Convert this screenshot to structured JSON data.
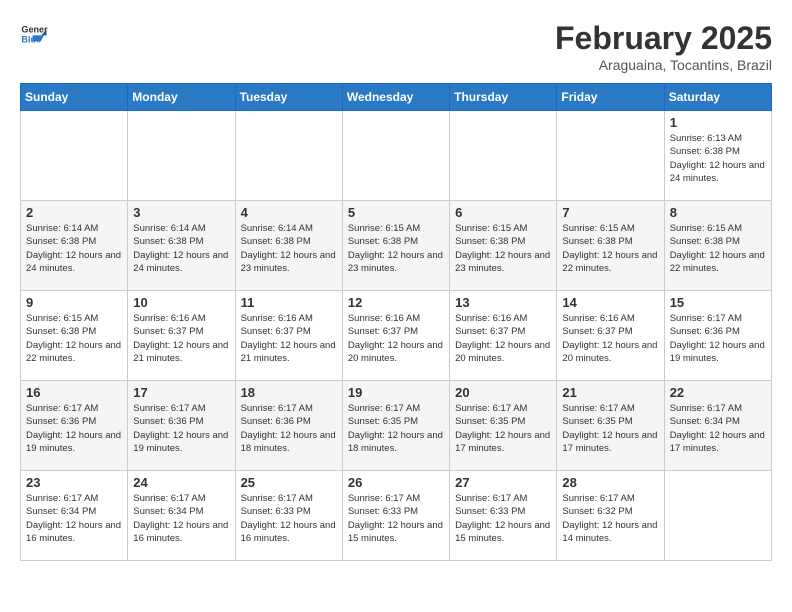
{
  "header": {
    "logo_general": "General",
    "logo_blue": "Blue",
    "month_title": "February 2025",
    "subtitle": "Araguaina, Tocantins, Brazil"
  },
  "weekdays": [
    "Sunday",
    "Monday",
    "Tuesday",
    "Wednesday",
    "Thursday",
    "Friday",
    "Saturday"
  ],
  "weeks": [
    [
      {
        "day": "",
        "info": ""
      },
      {
        "day": "",
        "info": ""
      },
      {
        "day": "",
        "info": ""
      },
      {
        "day": "",
        "info": ""
      },
      {
        "day": "",
        "info": ""
      },
      {
        "day": "",
        "info": ""
      },
      {
        "day": "1",
        "info": "Sunrise: 6:13 AM\nSunset: 6:38 PM\nDaylight: 12 hours and 24 minutes."
      }
    ],
    [
      {
        "day": "2",
        "info": "Sunrise: 6:14 AM\nSunset: 6:38 PM\nDaylight: 12 hours and 24 minutes."
      },
      {
        "day": "3",
        "info": "Sunrise: 6:14 AM\nSunset: 6:38 PM\nDaylight: 12 hours and 24 minutes."
      },
      {
        "day": "4",
        "info": "Sunrise: 6:14 AM\nSunset: 6:38 PM\nDaylight: 12 hours and 23 minutes."
      },
      {
        "day": "5",
        "info": "Sunrise: 6:15 AM\nSunset: 6:38 PM\nDaylight: 12 hours and 23 minutes."
      },
      {
        "day": "6",
        "info": "Sunrise: 6:15 AM\nSunset: 6:38 PM\nDaylight: 12 hours and 23 minutes."
      },
      {
        "day": "7",
        "info": "Sunrise: 6:15 AM\nSunset: 6:38 PM\nDaylight: 12 hours and 22 minutes."
      },
      {
        "day": "8",
        "info": "Sunrise: 6:15 AM\nSunset: 6:38 PM\nDaylight: 12 hours and 22 minutes."
      }
    ],
    [
      {
        "day": "9",
        "info": "Sunrise: 6:15 AM\nSunset: 6:38 PM\nDaylight: 12 hours and 22 minutes."
      },
      {
        "day": "10",
        "info": "Sunrise: 6:16 AM\nSunset: 6:37 PM\nDaylight: 12 hours and 21 minutes."
      },
      {
        "day": "11",
        "info": "Sunrise: 6:16 AM\nSunset: 6:37 PM\nDaylight: 12 hours and 21 minutes."
      },
      {
        "day": "12",
        "info": "Sunrise: 6:16 AM\nSunset: 6:37 PM\nDaylight: 12 hours and 20 minutes."
      },
      {
        "day": "13",
        "info": "Sunrise: 6:16 AM\nSunset: 6:37 PM\nDaylight: 12 hours and 20 minutes."
      },
      {
        "day": "14",
        "info": "Sunrise: 6:16 AM\nSunset: 6:37 PM\nDaylight: 12 hours and 20 minutes."
      },
      {
        "day": "15",
        "info": "Sunrise: 6:17 AM\nSunset: 6:36 PM\nDaylight: 12 hours and 19 minutes."
      }
    ],
    [
      {
        "day": "16",
        "info": "Sunrise: 6:17 AM\nSunset: 6:36 PM\nDaylight: 12 hours and 19 minutes."
      },
      {
        "day": "17",
        "info": "Sunrise: 6:17 AM\nSunset: 6:36 PM\nDaylight: 12 hours and 19 minutes."
      },
      {
        "day": "18",
        "info": "Sunrise: 6:17 AM\nSunset: 6:36 PM\nDaylight: 12 hours and 18 minutes."
      },
      {
        "day": "19",
        "info": "Sunrise: 6:17 AM\nSunset: 6:35 PM\nDaylight: 12 hours and 18 minutes."
      },
      {
        "day": "20",
        "info": "Sunrise: 6:17 AM\nSunset: 6:35 PM\nDaylight: 12 hours and 17 minutes."
      },
      {
        "day": "21",
        "info": "Sunrise: 6:17 AM\nSunset: 6:35 PM\nDaylight: 12 hours and 17 minutes."
      },
      {
        "day": "22",
        "info": "Sunrise: 6:17 AM\nSunset: 6:34 PM\nDaylight: 12 hours and 17 minutes."
      }
    ],
    [
      {
        "day": "23",
        "info": "Sunrise: 6:17 AM\nSunset: 6:34 PM\nDaylight: 12 hours and 16 minutes."
      },
      {
        "day": "24",
        "info": "Sunrise: 6:17 AM\nSunset: 6:34 PM\nDaylight: 12 hours and 16 minutes."
      },
      {
        "day": "25",
        "info": "Sunrise: 6:17 AM\nSunset: 6:33 PM\nDaylight: 12 hours and 16 minutes."
      },
      {
        "day": "26",
        "info": "Sunrise: 6:17 AM\nSunset: 6:33 PM\nDaylight: 12 hours and 15 minutes."
      },
      {
        "day": "27",
        "info": "Sunrise: 6:17 AM\nSunset: 6:33 PM\nDaylight: 12 hours and 15 minutes."
      },
      {
        "day": "28",
        "info": "Sunrise: 6:17 AM\nSunset: 6:32 PM\nDaylight: 12 hours and 14 minutes."
      },
      {
        "day": "",
        "info": ""
      }
    ]
  ]
}
